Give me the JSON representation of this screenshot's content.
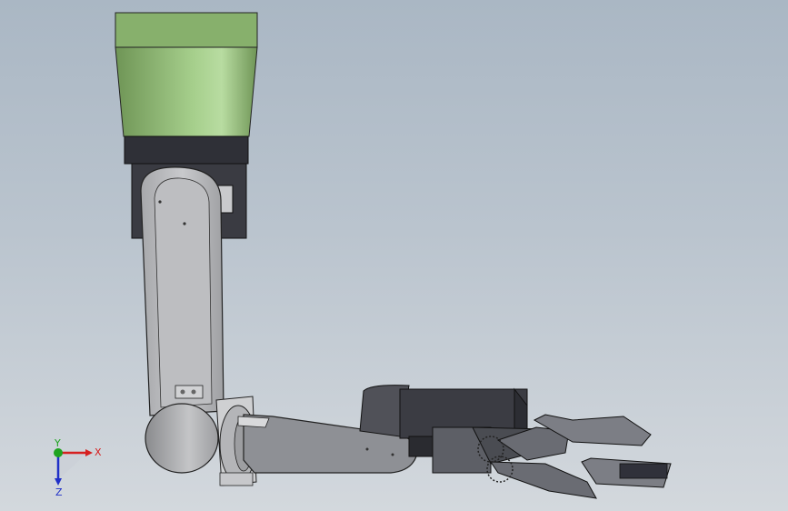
{
  "viewport": {
    "background_top": "#aab7c4",
    "background_bottom": "#d3d8dd"
  },
  "model": {
    "base_color": "#92b878",
    "collar_color": "#2e2f36",
    "arm_color": "#b9babd",
    "forearm_color": "#8f9196",
    "motor_color": "#3a3b42",
    "gripper_color": "#55575e"
  },
  "triad": {
    "x_label": "X",
    "y_label": "Y",
    "z_label": "Z",
    "x_color": "#d62020",
    "y_color": "#1fa31f",
    "z_color": "#2030c8"
  }
}
